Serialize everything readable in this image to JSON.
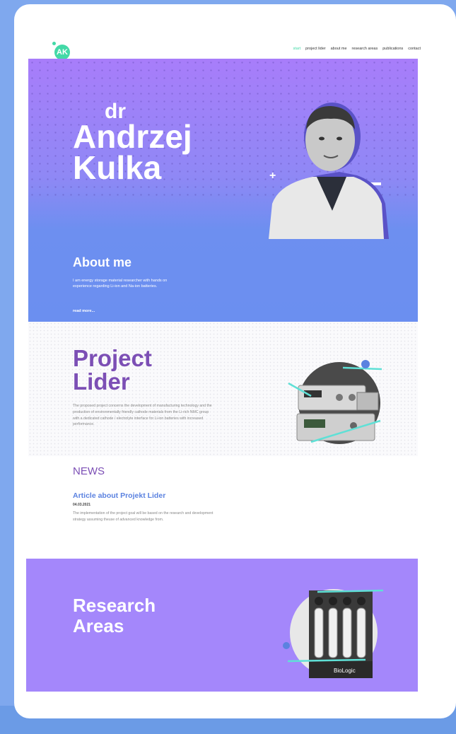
{
  "header": {
    "logo_text": "AK",
    "nav": [
      "start",
      "project lider",
      "about me",
      "research areas",
      "publications",
      "contact"
    ]
  },
  "hero": {
    "title_prefix": "dr",
    "first_name": "Andrzej",
    "last_name": "Kulka",
    "plus_symbol": "+"
  },
  "about": {
    "title": "About me",
    "text": "I am energy storage material researcher with hands on experience regarding Li-ion and Na-ion batteries.",
    "link": "read more..."
  },
  "project": {
    "title_line1": "Project",
    "title_line2": "Lider",
    "text": "The proposed project concerns the development of manufacturing technology and the production of environmentally friendly cathode materials from the Li-rich NMC group with a dedicated cathode / electrolyte interface for Li-ion batteries with increased performance."
  },
  "news": {
    "title": "NEWS",
    "article": {
      "title": "Article about Projekt Lider",
      "date": "04.03.2021",
      "text": "The implementation of the project goal will be based on the research and development strategy assuming theuse of advanced knowledge from."
    }
  },
  "research": {
    "title_line1": "Research",
    "title_line2": "Areas",
    "device_label": "BioLogic"
  },
  "colors": {
    "accent_green": "#43d9a7",
    "purple": "#7c4fb5",
    "blue": "#5b82e0",
    "research_bg": "#a487fb"
  }
}
